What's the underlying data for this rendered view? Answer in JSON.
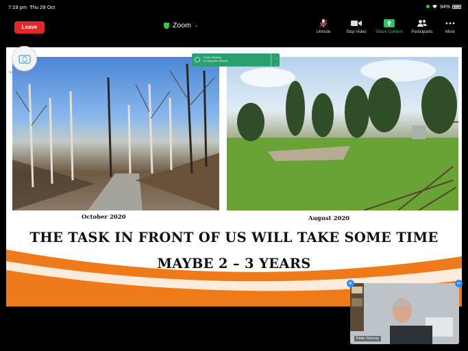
{
  "status_bar": {
    "time": "7:19 pm",
    "date": "Thu 29 Oct",
    "battery": "94%"
  },
  "toolbar": {
    "leave_label": "Leave",
    "title": "Zoom",
    "unmute_label": "Unmute",
    "stop_video_label": "Stop Video",
    "share_content_label": "Share Content",
    "participants_label": "Participants",
    "more_label": "More",
    "share_color": "#31c466",
    "leave_color": "#e02828"
  },
  "overlay": {
    "zoom_meeting_chip_title": "Zoom Meeting",
    "zoom_meeting_chip_sub": "is using the network",
    "switch_camera_label": "Switch Camera"
  },
  "slide": {
    "caption_left": "October 2020",
    "caption_right": "August 2020",
    "headline_1": "THE TASK IN FRONT OF US WILL TAKE SOME TIME",
    "headline_2": "MAYBE 2 – 3 YEARS",
    "accent_color": "#ef7a1a"
  },
  "video": {
    "participant_name": "Peter Sincrey"
  }
}
